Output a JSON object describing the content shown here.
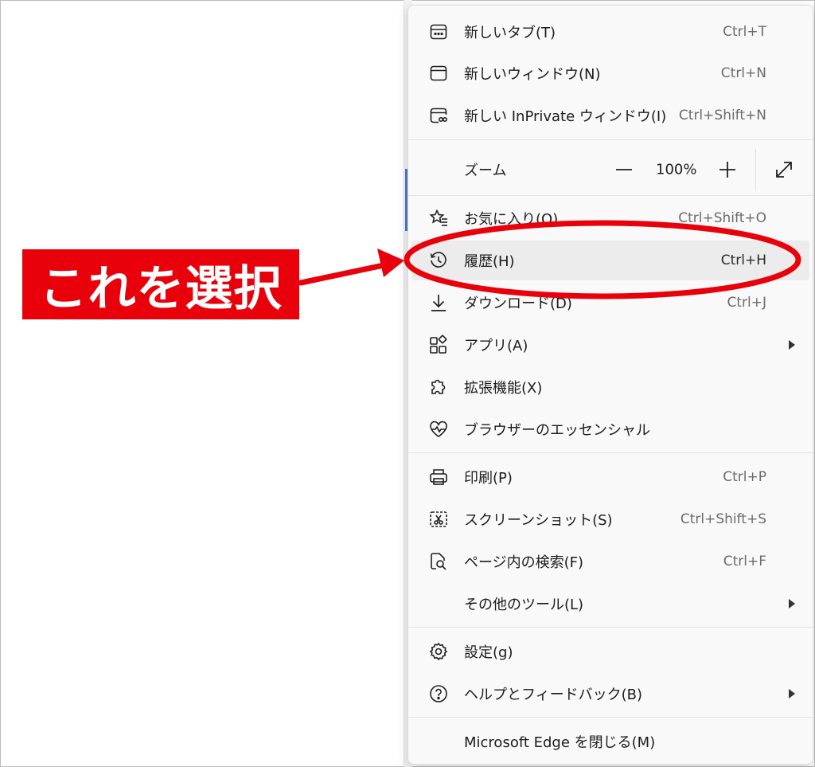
{
  "callout": {
    "text": "これを選択",
    "color": "#e8000b"
  },
  "menu": {
    "new_tab": {
      "label": "新しいタブ(T)",
      "shortcut": "Ctrl+T",
      "icon": "new-tab-icon"
    },
    "new_window": {
      "label": "新しいウィンドウ(N)",
      "shortcut": "Ctrl+N",
      "icon": "window-icon"
    },
    "new_inprivate": {
      "label": "新しい InPrivate ウィンドウ(I)",
      "shortcut": "Ctrl+Shift+N",
      "icon": "inprivate-icon"
    },
    "zoom": {
      "label": "ズーム",
      "value": "100%"
    },
    "favorites": {
      "label": "お気に入り(O)",
      "shortcut": "Ctrl+Shift+O",
      "icon": "favorites-star-icon"
    },
    "history": {
      "label": "履歴(H)",
      "shortcut": "Ctrl+H",
      "icon": "history-clock-icon"
    },
    "downloads": {
      "label": "ダウンロード(D)",
      "shortcut": "Ctrl+J",
      "icon": "download-icon"
    },
    "apps": {
      "label": "アプリ(A)",
      "icon": "apps-icon"
    },
    "extensions": {
      "label": "拡張機能(X)",
      "icon": "puzzle-icon"
    },
    "essentials": {
      "label": "ブラウザーのエッセンシャル",
      "icon": "heartbeat-icon"
    },
    "print": {
      "label": "印刷(P)",
      "shortcut": "Ctrl+P",
      "icon": "printer-icon"
    },
    "screenshot": {
      "label": "スクリーンショット(S)",
      "shortcut": "Ctrl+Shift+S",
      "icon": "screenshot-icon"
    },
    "find": {
      "label": "ページ内の検索(F)",
      "shortcut": "Ctrl+F",
      "icon": "find-in-page-icon"
    },
    "more_tools": {
      "label": "その他のツール(L)"
    },
    "settings": {
      "label": "設定(g)",
      "icon": "gear-icon"
    },
    "help": {
      "label": "ヘルプとフィードバック(B)",
      "icon": "help-icon"
    },
    "close": {
      "label": "Microsoft Edge を閉じる(M)"
    }
  },
  "colors": {
    "highlight": "#e8000b",
    "menu_bg": "#f9f9f9",
    "hover_bg": "#ececec"
  }
}
